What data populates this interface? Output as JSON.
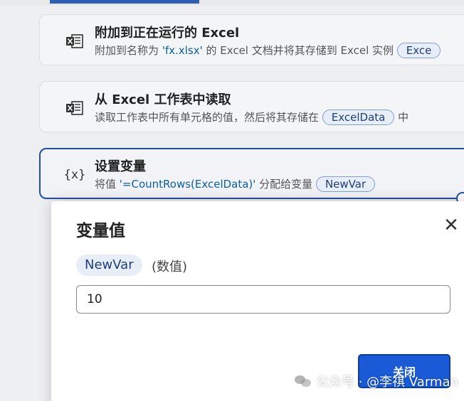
{
  "actions": [
    {
      "icon": "excel-attach-icon",
      "title": "附加到正在运行的 Excel",
      "desc_prefix": "附加到名称为 ",
      "desc_literal": "'fx.xlsx'",
      "desc_middle": " 的 Excel 文档并将其存储到 Excel 实例 ",
      "chip": "Exce",
      "desc_suffix": ""
    },
    {
      "icon": "excel-read-icon",
      "title": "从 Excel 工作表中读取",
      "desc_prefix": "读取工作表中所有单元格的值，然后将其存储在 ",
      "desc_literal": "",
      "desc_middle": "",
      "chip": "ExcelData",
      "desc_suffix": " 中"
    },
    {
      "icon": "variable-icon",
      "icon_glyph": "{x}",
      "title": "设置变量",
      "desc_prefix": "将值 ",
      "desc_literal": "'=CountRows(ExcelData)'",
      "desc_middle": " 分配给变量 ",
      "chip": "NewVar",
      "desc_suffix": ""
    }
  ],
  "dialog": {
    "title": "变量值",
    "close_glyph": "✕",
    "variable_name": "NewVar",
    "variable_type": "(数值)",
    "value": "10",
    "close_button_label": "关闭"
  },
  "watermark": {
    "text": "公众号 · @李祺 Varman"
  },
  "colors": {
    "accent": "#1a5ad6",
    "selected_border": "#1f4fa8",
    "literal": "#0b5fa8"
  }
}
